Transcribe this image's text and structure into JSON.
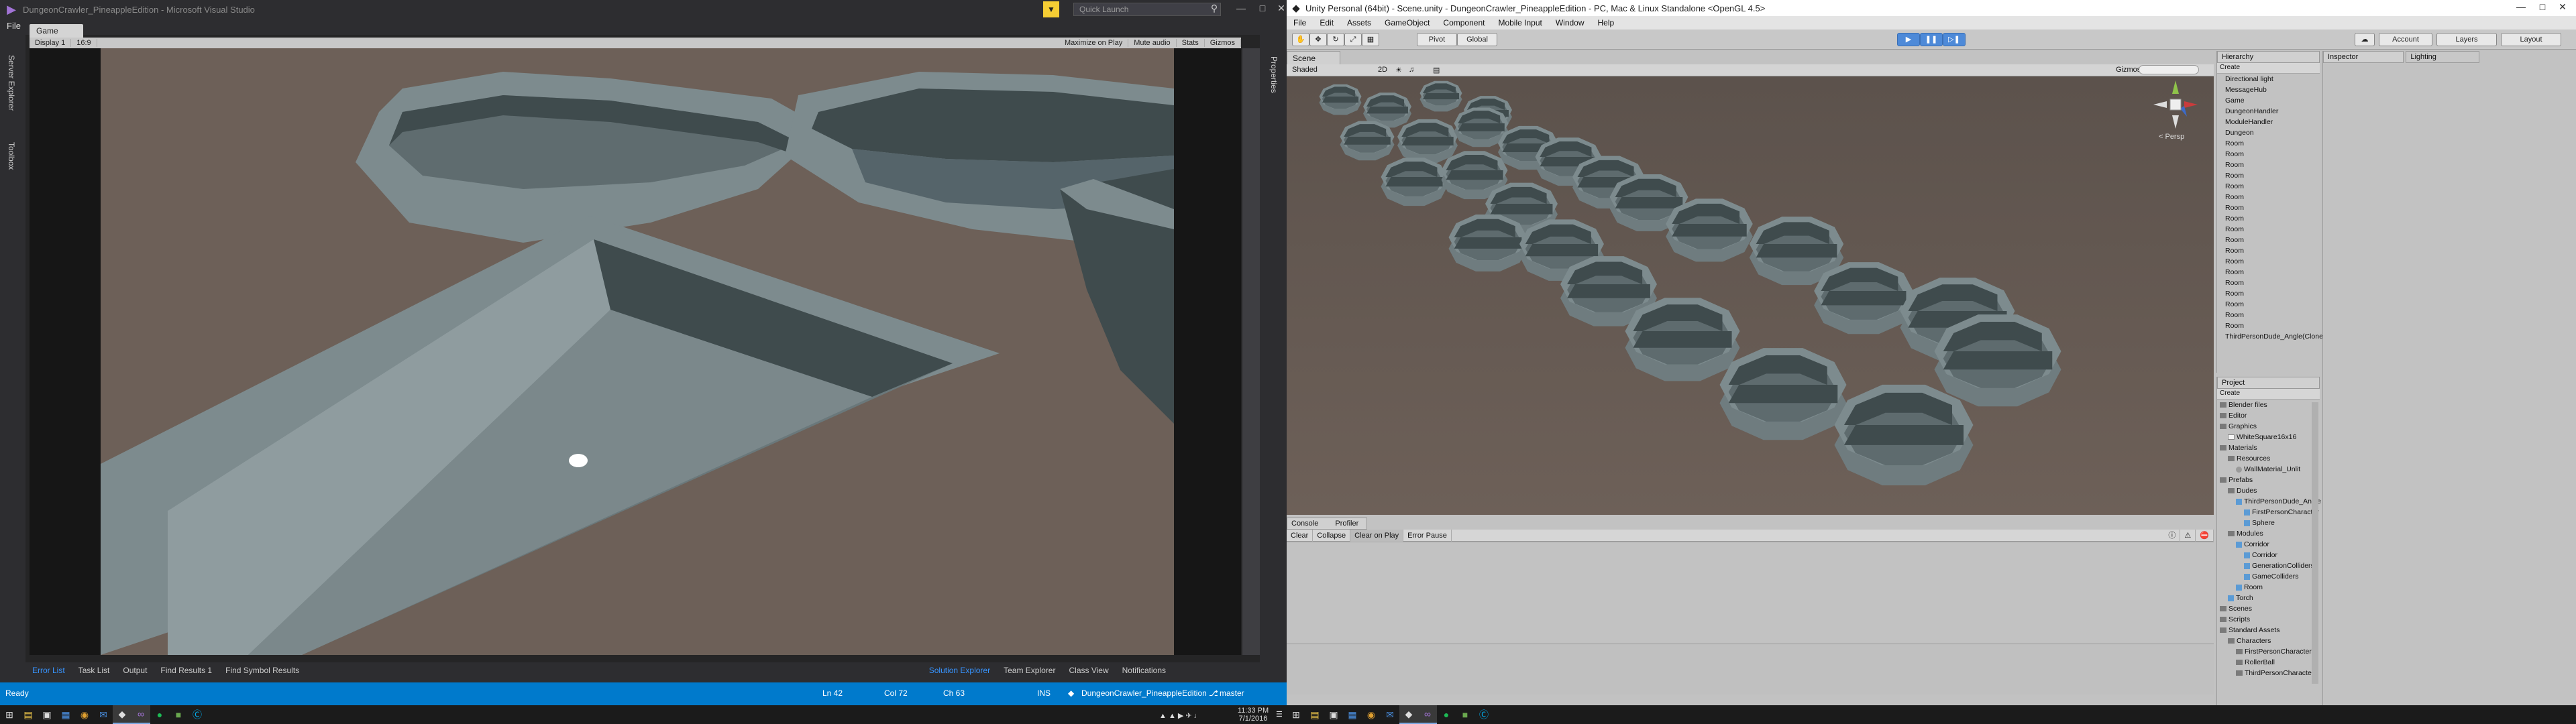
{
  "colors": {
    "vs_accent": "#007acc",
    "vs_chrome": "#2d2d30",
    "unity_chrome": "#c2c2c2",
    "scene_ground": "#6d6058",
    "wall_light": "#7d8b8e",
    "wall_dark": "#3f4b4d",
    "play_blue": "#4e8ad8"
  },
  "vs": {
    "title": "DungeonCrawler_PineappleEdition - Microsoft Visual Studio",
    "quick_launch_placeholder": "Quick Launch",
    "menu_file": "File",
    "left_sidebar": [
      "Server Explorer",
      "Toolbox"
    ],
    "right_sidebar": [
      "Properties"
    ],
    "game_tab": "Game",
    "game_toolbar": {
      "display": "Display 1",
      "aspect": "16:9",
      "maximize": "Maximize on Play",
      "mute": "Mute audio",
      "stats": "Stats",
      "gizmos": "Gizmos"
    },
    "bottom_tabs": [
      "Error List",
      "Task List",
      "Output",
      "Find Results 1",
      "Find Symbol Results"
    ],
    "right_tabs": [
      "Solution Explorer",
      "Team Explorer",
      "Class View",
      "Notifications"
    ],
    "status": {
      "ready": "Ready",
      "ln": "Ln 42",
      "col": "Col 72",
      "ch": "Ch 63",
      "ins": "INS",
      "project": "DungeonCrawler_PineappleEdition",
      "branch": "master"
    }
  },
  "unity": {
    "title": "Unity Personal (64bit) - Scene.unity - DungeonCrawler_PineappleEdition - PC, Mac & Linux Standalone <OpenGL 4.5>",
    "menu": [
      "File",
      "Edit",
      "Assets",
      "GameObject",
      "Component",
      "Mobile Input",
      "Window",
      "Help"
    ],
    "pivot": "Pivot",
    "global": "Global",
    "account": "Account",
    "layers": "Layers",
    "layout": "Layout",
    "scene_tab": "Scene",
    "scene_toolbar": {
      "shaded": "Shaded",
      "mode2d": "2D",
      "gizmos": "Gizmos"
    },
    "persp_label": "< Persp",
    "console_tab": "Console",
    "profiler_tab": "Profiler",
    "console_buttons": [
      "Clear",
      "Collapse",
      "Clear on Play",
      "Error Pause"
    ],
    "hierarchy_tab": "Hierarchy",
    "create": "Create",
    "hierarchy": [
      "Directional light",
      "MessageHub",
      "Game",
      "DungeonHandler",
      "ModuleHandler",
      "Dungeon",
      "Room",
      "Room",
      "Room",
      "Room",
      "Room",
      "Room",
      "Room",
      "Room",
      "Room",
      "Room",
      "Room",
      "Room",
      "Room",
      "Room",
      "Room",
      "Room",
      "Room",
      "Room",
      "ThirdPersonDude_Angle(Clone)"
    ],
    "project_tab": "Project",
    "project": [
      {
        "label": "Blender files",
        "indent": 0,
        "kind": "folder"
      },
      {
        "label": "Editor",
        "indent": 0,
        "kind": "folder"
      },
      {
        "label": "Graphics",
        "indent": 0,
        "kind": "folder"
      },
      {
        "label": "WhiteSquare16x16",
        "indent": 1,
        "kind": "file"
      },
      {
        "label": "Materials",
        "indent": 0,
        "kind": "folder"
      },
      {
        "label": "Resources",
        "indent": 1,
        "kind": "folder"
      },
      {
        "label": "WallMaterial_Unlit",
        "indent": 2,
        "kind": "mat"
      },
      {
        "label": "Prefabs",
        "indent": 0,
        "kind": "folder"
      },
      {
        "label": "Dudes",
        "indent": 1,
        "kind": "folder"
      },
      {
        "label": "ThirdPersonDude_Angle",
        "indent": 2,
        "kind": "prefab"
      },
      {
        "label": "FirstPersonCharacter",
        "indent": 3,
        "kind": "prefab"
      },
      {
        "label": "Sphere",
        "indent": 3,
        "kind": "prefab"
      },
      {
        "label": "Modules",
        "indent": 1,
        "kind": "folder"
      },
      {
        "label": "Corridor",
        "indent": 2,
        "kind": "prefab"
      },
      {
        "label": "Corridor",
        "indent": 3,
        "kind": "prefab"
      },
      {
        "label": "GenerationColliders",
        "indent": 3,
        "kind": "prefab"
      },
      {
        "label": "GameColliders",
        "indent": 3,
        "kind": "prefab"
      },
      {
        "label": "Room",
        "indent": 2,
        "kind": "prefab"
      },
      {
        "label": "Torch",
        "indent": 1,
        "kind": "prefab"
      },
      {
        "label": "Scenes",
        "indent": 0,
        "kind": "folder"
      },
      {
        "label": "Scripts",
        "indent": 0,
        "kind": "folder"
      },
      {
        "label": "Standard Assets",
        "indent": 0,
        "kind": "folder"
      },
      {
        "label": "Characters",
        "indent": 1,
        "kind": "folder"
      },
      {
        "label": "FirstPersonCharacter",
        "indent": 2,
        "kind": "folder"
      },
      {
        "label": "RollerBall",
        "indent": 2,
        "kind": "folder"
      },
      {
        "label": "ThirdPersonCharacter",
        "indent": 2,
        "kind": "folder"
      }
    ],
    "inspector_tab": "Inspector",
    "lighting_tab": "Lighting"
  },
  "taskbar": {
    "time": "11:33 PM",
    "date": "7/1/2016"
  }
}
